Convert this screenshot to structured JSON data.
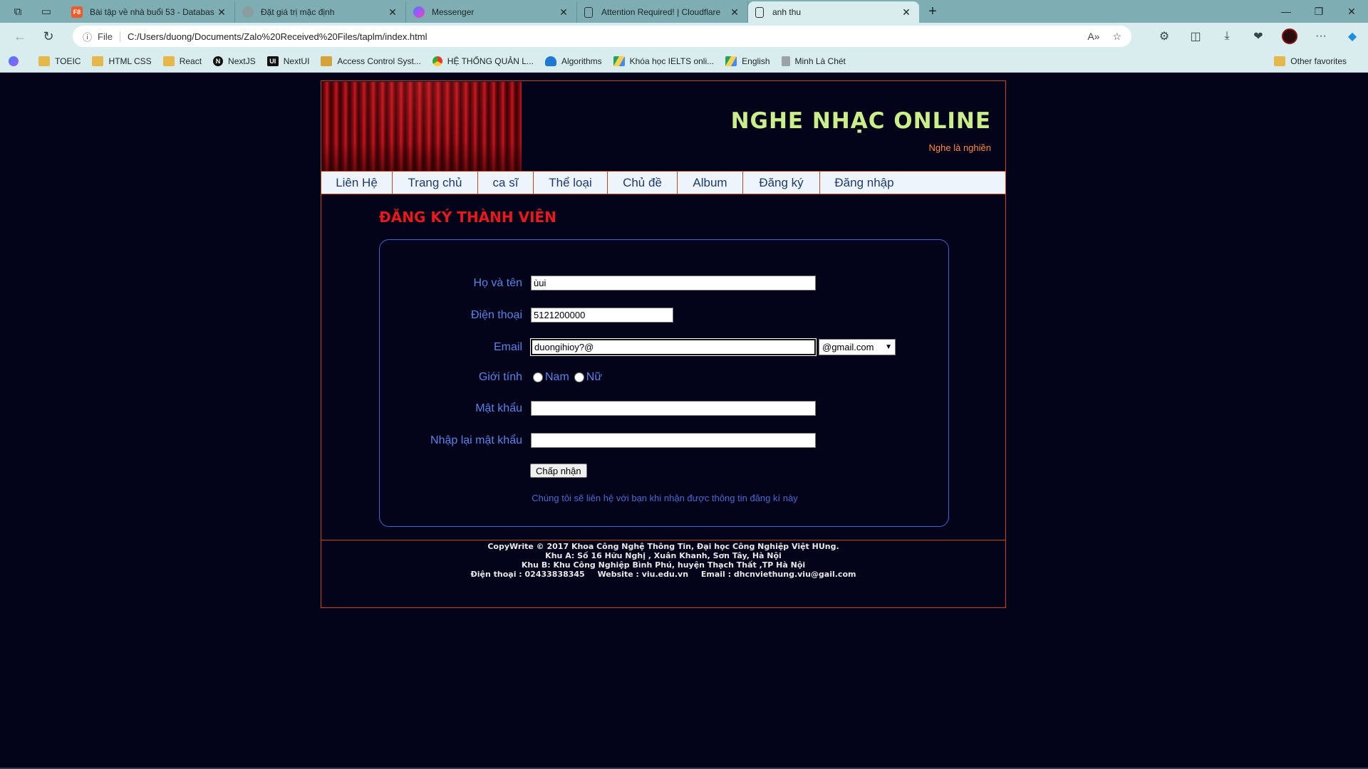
{
  "browser": {
    "tabs": [
      {
        "label": "Bài tập về nhà buổi 53 - Databas",
        "favicon": "F8",
        "favicon_color": "#f05a28"
      },
      {
        "label": "Đặt giá trị mặc định",
        "favicon": "",
        "favicon_color": "#8a9ea0"
      },
      {
        "label": "Messenger",
        "favicon": "",
        "favicon_color": "#a855f7"
      },
      {
        "label": "Attention Required! | Cloudflare",
        "favicon": "",
        "favicon_color": "#7c8a8c"
      },
      {
        "label": "anh thu",
        "favicon": "",
        "favicon_color": "#7c8a8c",
        "active": true
      }
    ],
    "address": {
      "scheme": "File",
      "url": "C:/Users/duong/Documents/Zalo%20Received%20Files/taplm/index.html"
    },
    "bookmarks": [
      {
        "label": "",
        "icon": "messenger-icon"
      },
      {
        "label": "TOEIC",
        "icon": "folder-icon"
      },
      {
        "label": "HTML CSS",
        "icon": "folder-icon"
      },
      {
        "label": "React",
        "icon": "folder-icon"
      },
      {
        "label": "NextJS",
        "icon": "nextjs-icon"
      },
      {
        "label": "NextUI",
        "icon": "nextui-icon"
      },
      {
        "label": "Access Control Syst...",
        "icon": "access-control-icon"
      },
      {
        "label": "HỆ THỐNG QUẢN L...",
        "icon": "chrome-icon"
      },
      {
        "label": "Algorithms",
        "icon": "cloud-icon"
      },
      {
        "label": "Khóa học IELTS onli...",
        "icon": "drive-icon"
      },
      {
        "label": "English",
        "icon": "drive-icon"
      },
      {
        "label": "Minh Là Chét",
        "icon": "sheet-icon"
      }
    ],
    "other_favorites": "Other favorites"
  },
  "site": {
    "title": "NGHE NHẠC ONLINE",
    "subtitle": "Nghe là nghiền",
    "menu": [
      "Liên Hệ",
      "Trang chủ",
      "ca sĩ",
      "Thể loại",
      "Chủ đề",
      "Album",
      "Đăng ký",
      "Đăng nhập"
    ]
  },
  "form": {
    "title": "ĐĂNG KÝ THÀNH VIÊN",
    "fullname": {
      "label": "Họ và tên",
      "value": "ùui"
    },
    "phone": {
      "label": "Điện thoại",
      "value": "5121200000"
    },
    "email": {
      "label": "Email",
      "value": "duongihioy?@",
      "domain": "@gmail.com"
    },
    "gender": {
      "label": "Giới tính",
      "options": [
        "Nam",
        "Nữ"
      ]
    },
    "password": {
      "label": "Mật khẩu",
      "value": ""
    },
    "confirm": {
      "label": "Nhập lại mật khẩu",
      "value": ""
    },
    "submit": "Chấp nhận",
    "note": "Chúng tôi sẽ liên hệ với bạn khi nhận được thông tin đăng kí này"
  },
  "footer": {
    "line1": "CopyWrite © 2017 Khoa Công Nghệ Thông Tin, Đại học Công Nghiệp Việt HUng.",
    "line2": "Khu A: Số 16 Hữu Nghị , Xuân Khanh, Sơn Tây, Hà Nội",
    "line3": "Khu B: Khu Công Nghiệp Bình Phú, huyện Thạch Thất ,TP Hà Nội",
    "phone": "Điện thoại : 02433838345",
    "website": "Website : viu.edu.vn",
    "email": "Email : dhcnviethung.viu@gail.com"
  },
  "colors": {
    "page_bg": "#03031a",
    "border": "#c9431f",
    "title": "#c9ee8a",
    "form_title": "#e8181e",
    "label": "#5a84e8"
  }
}
